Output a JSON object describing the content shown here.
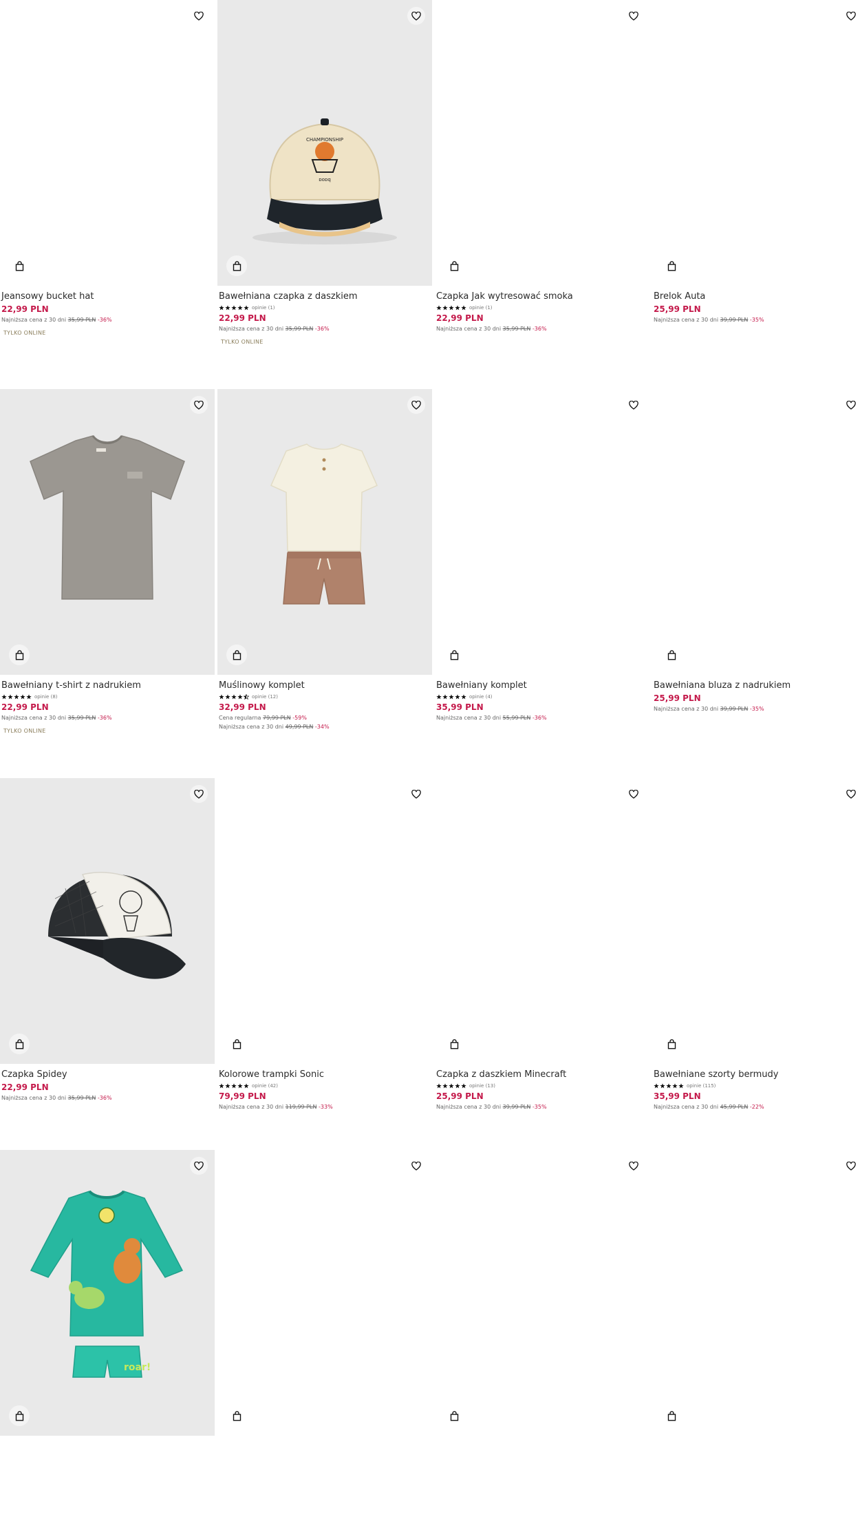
{
  "products": [
    {
      "name": "Jeansowy bucket hat",
      "price": "22,99 PLN",
      "lowest_label": "Najniższa cena z 30 dni",
      "lowest_old": "35,99 PLN",
      "lowest_disc": "-36%",
      "badge": "TYLKO ONLINE",
      "icon": "empty"
    },
    {
      "name": "Bawełniana czapka z daszkiem",
      "rating": 5,
      "reviews": "opinie (1)",
      "price": "22,99 PLN",
      "lowest_label": "Najniższa cena z 30 dni",
      "lowest_old": "35,99 PLN",
      "lowest_disc": "-36%",
      "badge": "TYLKO ONLINE",
      "icon": "cap-basketball"
    },
    {
      "name": "Czapka Jak wytresować smoka",
      "rating": 5,
      "reviews": "opinie (1)",
      "price": "22,99 PLN",
      "lowest_label": "Najniższa cena z 30 dni",
      "lowest_old": "35,99 PLN",
      "lowest_disc": "-36%",
      "icon": "empty"
    },
    {
      "name": "Brelok Auta",
      "price": "25,99 PLN",
      "lowest_label": "Najniższa cena z 30 dni",
      "lowest_old": "39,99 PLN",
      "lowest_disc": "-35%",
      "icon": "empty"
    },
    {
      "name": "Bawełniany t-shirt z nadrukiem",
      "rating": 5,
      "reviews": "opinie (8)",
      "price": "22,99 PLN",
      "lowest_label": "Najniższa cena z 30 dni",
      "lowest_old": "35,99 PLN",
      "lowest_disc": "-36%",
      "badge": "TYLKO ONLINE",
      "icon": "tshirt-grey"
    },
    {
      "name": "Muślinowy komplet",
      "rating": 4.5,
      "reviews": "opinie (12)",
      "price": "32,99 PLN",
      "regular_label": "Cena regularna",
      "regular_old": "79,99 PLN",
      "regular_disc": "-59%",
      "lowest_label": "Najniższa cena z 30 dni",
      "lowest_old": "49,99 PLN",
      "lowest_disc": "-34%",
      "icon": "muslin-set"
    },
    {
      "name": "Bawełniany komplet",
      "rating": 5,
      "reviews": "opinie (4)",
      "price": "35,99 PLN",
      "lowest_label": "Najniższa cena z 30 dni",
      "lowest_old": "55,99 PLN",
      "lowest_disc": "-36%",
      "icon": "empty"
    },
    {
      "name": "Bawełniana bluza z nadrukiem",
      "price": "25,99 PLN",
      "lowest_label": "Najniższa cena z 30 dni",
      "lowest_old": "39,99 PLN",
      "lowest_disc": "-35%",
      "icon": "empty"
    },
    {
      "name": "Czapka Spidey",
      "price": "22,99 PLN",
      "lowest_label": "Najniższa cena z 30 dni",
      "lowest_old": "35,99 PLN",
      "lowest_disc": "-36%",
      "icon": "cap-spidey"
    },
    {
      "name": "Kolorowe trampki Sonic",
      "rating": 5,
      "reviews": "opinie (42)",
      "price": "79,99 PLN",
      "lowest_label": "Najniższa cena z 30 dni",
      "lowest_old": "119,99 PLN",
      "lowest_disc": "-33%",
      "icon": "empty"
    },
    {
      "name": "Czapka z daszkiem Minecraft",
      "rating": 5,
      "reviews": "opinie (13)",
      "price": "25,99 PLN",
      "lowest_label": "Najniższa cena z 30 dni",
      "lowest_old": "39,99 PLN",
      "lowest_disc": "-35%",
      "icon": "empty"
    },
    {
      "name": "Bawełniane szorty bermudy",
      "rating": 5,
      "reviews": "opinie (115)",
      "price": "35,99 PLN",
      "lowest_label": "Najniższa cena z 30 dni",
      "lowest_old": "45,99 PLN",
      "lowest_disc": "-22%",
      "icon": "empty"
    },
    {
      "icon": "swim-set-dino"
    },
    {
      "icon": "empty"
    },
    {
      "icon": "empty"
    },
    {
      "icon": "empty"
    }
  ],
  "ui": {
    "favorite_icon": "heart-outline-icon",
    "cart_icon": "shopping-bag-icon",
    "accent_price": "#c41a4b"
  }
}
